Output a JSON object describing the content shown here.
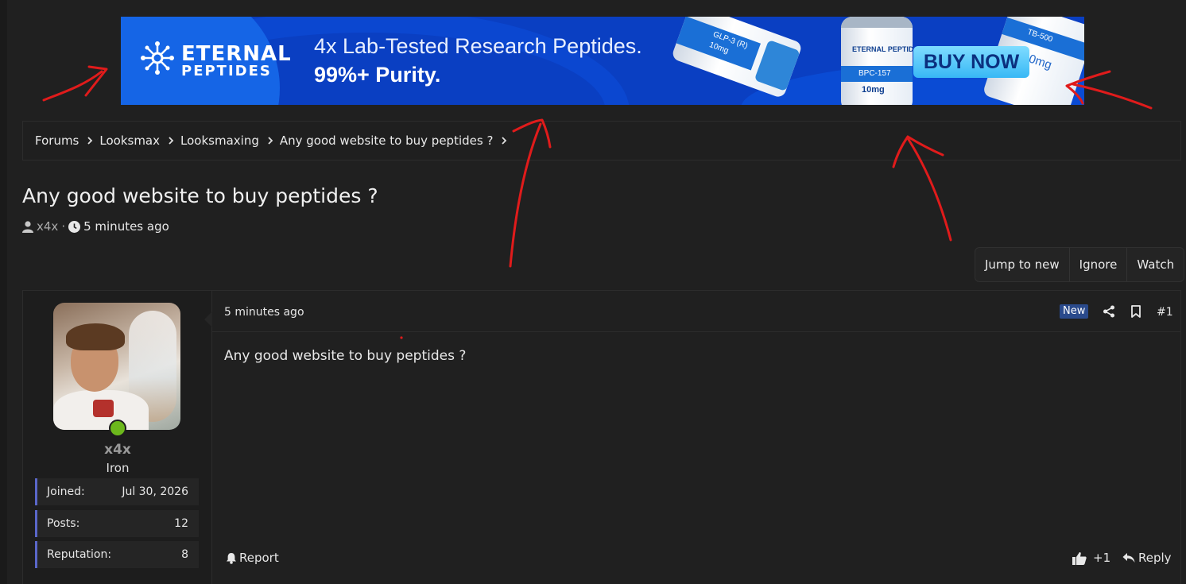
{
  "banner": {
    "brand_line1": "ETERNAL",
    "brand_line2": "PEPTIDES",
    "headline": "4x Lab-Tested Research Peptides.",
    "subheadline": "99%+ Purity.",
    "cta_label": "BUY NOW",
    "vials": [
      {
        "name": "GLP-3 (R)",
        "dose": "10mg"
      },
      {
        "name": "BPC-157",
        "dose": "10mg"
      },
      {
        "name": "TB-500",
        "dose": "10mg"
      }
    ],
    "colors": {
      "background": "#0a3fc2",
      "cta": "#38b8f5"
    }
  },
  "breadcrumb": {
    "items": [
      "Forums",
      "Looksmax",
      "Looksmaxing",
      "Any good website to buy peptides ?"
    ]
  },
  "thread": {
    "title": "Any good website to buy peptides ?",
    "author": "x4x",
    "separator": "·",
    "posted": "5 minutes ago",
    "actions": {
      "jump": "Jump to new",
      "ignore": "Ignore",
      "watch": "Watch"
    }
  },
  "post": {
    "time": "5 minutes ago",
    "badge": "New",
    "number": "#1",
    "content": "Any good website to buy peptides ?",
    "report_label": "Report",
    "like_label": "+1",
    "reply_label": "Reply"
  },
  "user": {
    "name": "x4x",
    "title": "Iron",
    "online": true,
    "stats": {
      "joined_label": "Joined:",
      "joined_value": "Jul 30, 2026",
      "posts_label": "Posts:",
      "posts_value": "12",
      "rep_label": "Reputation:",
      "rep_value": "8"
    }
  },
  "colors": {
    "background": "#202020",
    "accent": "#5a67c9",
    "online": "#6cb81c",
    "annotation": "#e01b1b"
  }
}
